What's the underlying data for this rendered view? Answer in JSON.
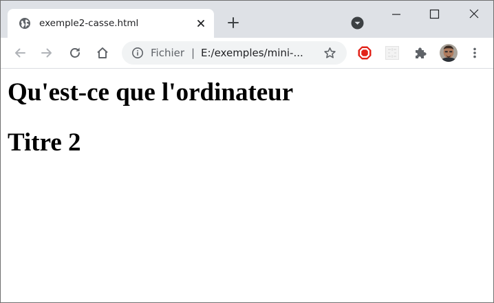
{
  "tab": {
    "title": "exemple2-casse.html",
    "favicon": "globe-icon",
    "close_icon": "close-icon"
  },
  "tabstrip": {
    "new_tab_icon": "plus-icon",
    "tab_search_icon": "chevron-down-icon"
  },
  "window_controls": {
    "minimize_icon": "minimize-icon",
    "maximize_icon": "maximize-icon",
    "close_icon": "close-icon"
  },
  "toolbar": {
    "back_icon": "arrow-left-icon",
    "forward_icon": "arrow-right-icon",
    "reload_icon": "reload-icon",
    "home_icon": "home-icon",
    "extensions": [
      "ublock-icon",
      "extension-placeholder-icon",
      "puzzle-icon"
    ],
    "profile_icon": "avatar",
    "menu_icon": "kebab-menu-icon"
  },
  "omnibox": {
    "security_icon": "info-icon",
    "scheme_label": "Fichier",
    "separator": "|",
    "url": "E:/exemples/mini-...",
    "bookmark_icon": "star-icon"
  },
  "page": {
    "heading1": "Qu'est-ce que l'ordinateur",
    "heading2": "Titre 2"
  },
  "colors": {
    "tabstrip_bg": "#dee1e6",
    "omnibox_bg": "#f1f3f4",
    "ublock_red": "#e2231a"
  }
}
